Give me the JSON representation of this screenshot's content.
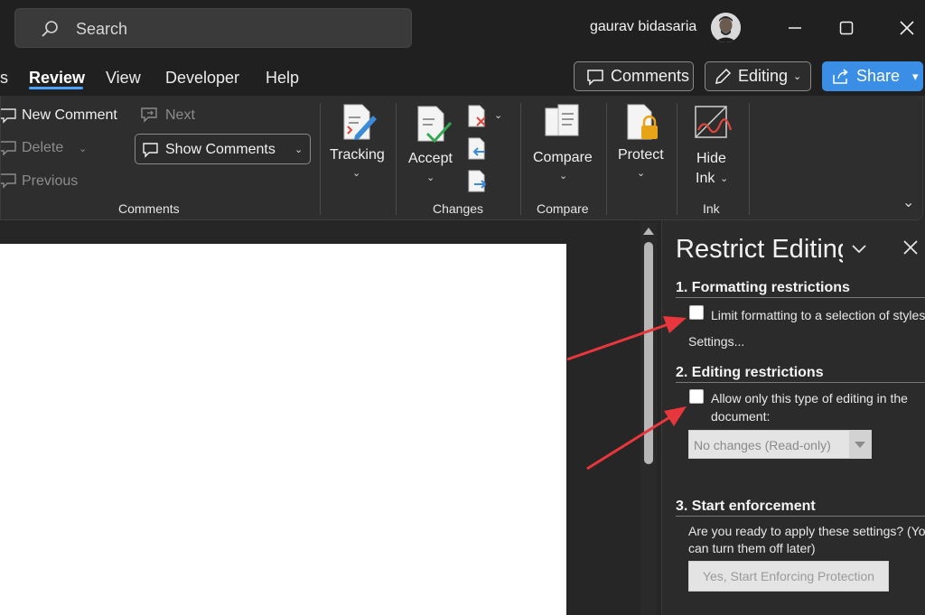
{
  "titlebar": {
    "search_placeholder": "Search",
    "user_name": "gaurav bidasaria"
  },
  "tabs": {
    "partial_left": "s",
    "items": [
      "Review",
      "View",
      "Developer",
      "Help"
    ],
    "active": "Review",
    "comments_button": "Comments",
    "editing_button": "Editing",
    "share_button": "Share"
  },
  "ribbon": {
    "comments_group": {
      "new_comment": "New Comment",
      "next": "Next",
      "delete": "Delete",
      "previous": "Previous",
      "show_comments": "Show Comments",
      "label": "Comments"
    },
    "tracking": "Tracking",
    "accept": "Accept",
    "changes_label": "Changes",
    "compare": "Compare",
    "compare_label": "Compare",
    "protect": "Protect",
    "hide": "Hide",
    "ink_btn": "Ink",
    "ink_label": "Ink"
  },
  "pane": {
    "title": "Restrict Editing",
    "section1_title": "1. Formatting restrictions",
    "section1_checkbox": "Limit formatting to a selection of styles",
    "section1_settings": "Settings...",
    "section2_title": "2. Editing restrictions",
    "section2_checkbox_line1": "Allow only this type of editing in the",
    "section2_checkbox_line2": "document:",
    "section2_select": "No changes (Read-only)",
    "section3_title": "3. Start enforcement",
    "section3_text_line1": "Are you ready to apply these settings? (You",
    "section3_text_line2": "can turn them off later)",
    "section3_button": "Yes, Start Enforcing Protection"
  },
  "colors": {
    "accent": "#3a8ee6",
    "annotation_arrow": "#e8373c",
    "tab_underline": "#4ba3ff"
  }
}
